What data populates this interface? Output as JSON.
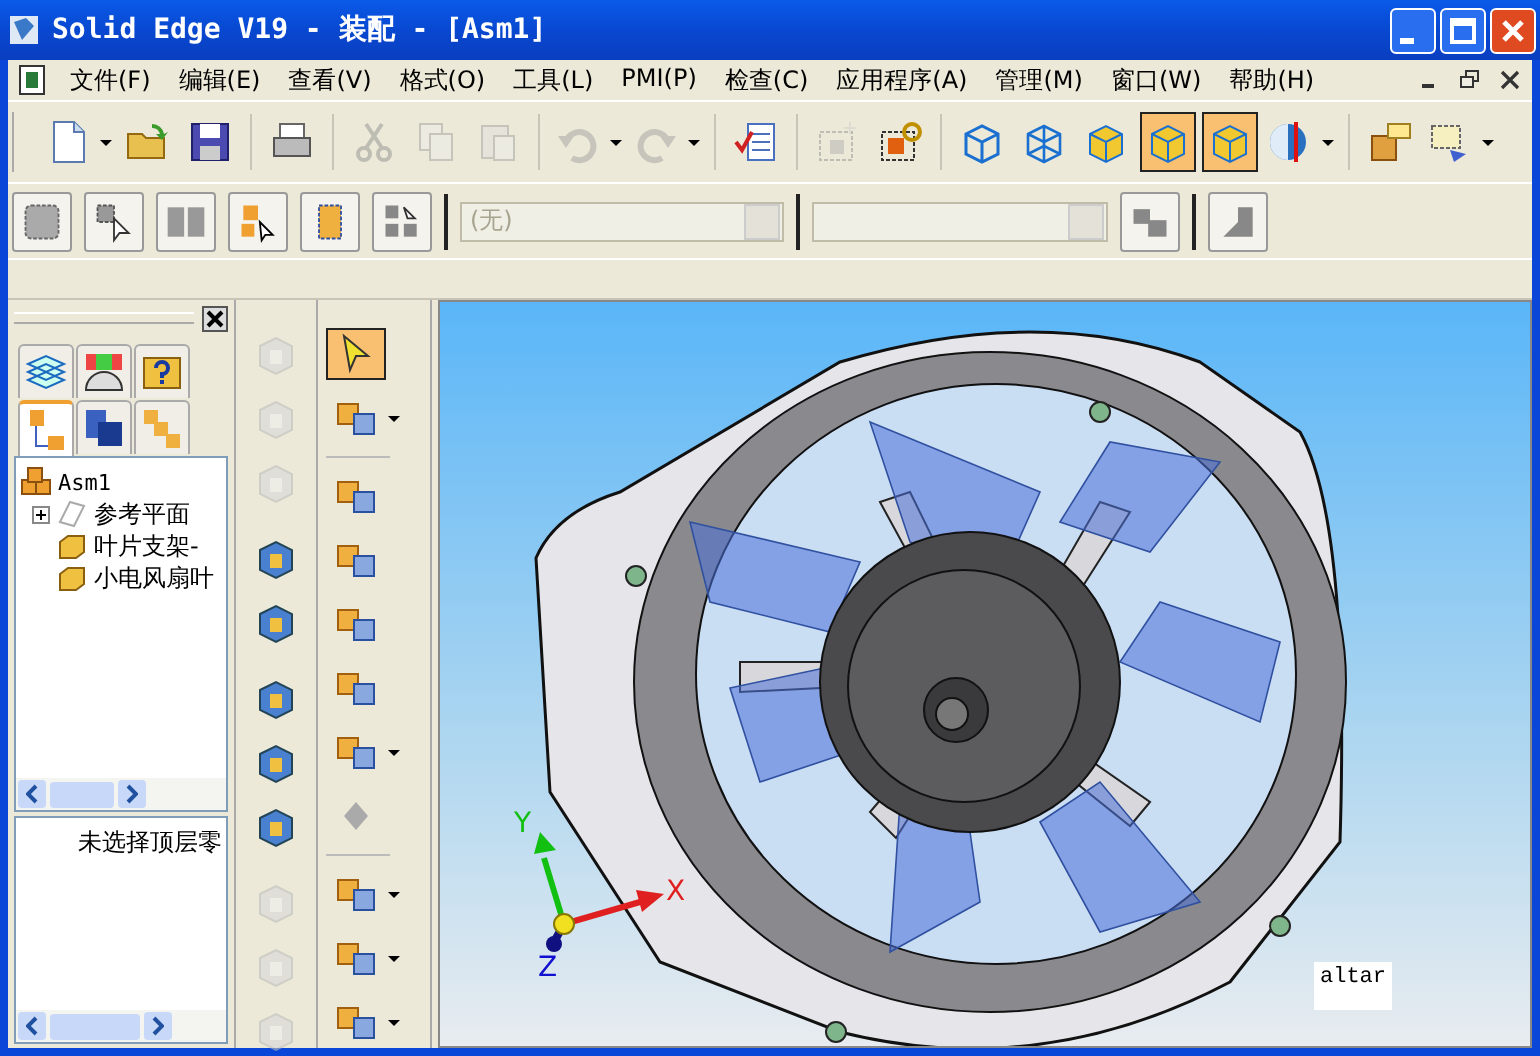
{
  "window": {
    "title": "Solid Edge V19 - 装配 - [Asm1]"
  },
  "menu": [
    "文件(F)",
    "编辑(E)",
    "查看(V)",
    "格式(O)",
    "工具(L)",
    "PMI(P)",
    "检查(C)",
    "应用程序(A)",
    "管理(M)",
    "窗口(W)",
    "帮助(H)"
  ],
  "toolbar": [
    {
      "dropdown": true,
      "disabled": false,
      "selected": false
    },
    {
      "dropdown": false,
      "disabled": false,
      "selected": false
    },
    {
      "dropdown": false,
      "disabled": false,
      "selected": false
    },
    {
      "dropdown": false,
      "disabled": false,
      "selected": false
    },
    {
      "dropdown": false,
      "disabled": true,
      "selected": false
    },
    {
      "dropdown": false,
      "disabled": true,
      "selected": false
    },
    {
      "dropdown": false,
      "disabled": true,
      "selected": false
    },
    {
      "dropdown": true,
      "disabled": true,
      "selected": false
    },
    {
      "dropdown": true,
      "disabled": true,
      "selected": false
    },
    {
      "dropdown": false,
      "disabled": false,
      "selected": false
    },
    {
      "dropdown": false,
      "disabled": true,
      "selected": false
    },
    {
      "dropdown": false,
      "disabled": false,
      "selected": false
    },
    {
      "dropdown": false,
      "disabled": false,
      "selected": false
    },
    {
      "dropdown": false,
      "disabled": false,
      "selected": false
    },
    {
      "dropdown": false,
      "disabled": false,
      "selected": false
    },
    {
      "dropdown": false,
      "disabled": false,
      "selected": true
    },
    {
      "dropdown": false,
      "disabled": false,
      "selected": true
    },
    {
      "dropdown": true,
      "disabled": false,
      "selected": false
    },
    {
      "dropdown": false,
      "disabled": false,
      "selected": false
    },
    {
      "dropdown": true,
      "disabled": false,
      "selected": false
    }
  ],
  "toolbar2": {
    "layer_select": {
      "value": "(无)",
      "disabled": true
    },
    "style_select": {
      "disabled": true
    }
  },
  "panel": {
    "tabs": [
      {
        "selected": false
      },
      {
        "selected": false
      },
      {
        "selected": false
      },
      {
        "selected": true
      },
      {
        "selected": false
      },
      {
        "selected": false
      }
    ],
    "tree": [
      {
        "label": "Asm1",
        "children": [
          {
            "label": "参考平面",
            "expanded": false,
            "expandable": true
          },
          {
            "label": "叶片支架-",
            "expandable": false
          },
          {
            "label": "小电风扇叶",
            "expandable": false
          }
        ]
      }
    ],
    "details_text": "未选择顶层零"
  },
  "commands_a": [
    {
      "disabled": true
    },
    {
      "disabled": true
    },
    {
      "disabled": true
    },
    {
      "disabled": false
    },
    {
      "disabled": false
    },
    {
      "disabled": false
    },
    {
      "disabled": false
    },
    {
      "disabled": false
    },
    {
      "disabled": true
    },
    {
      "disabled": true
    },
    {
      "disabled": true
    }
  ],
  "commands_b": [
    {
      "selected": true,
      "dropdown": false
    },
    {
      "selected": false,
      "dropdown": true
    },
    {
      "selected": false,
      "dropdown": false
    },
    {
      "selected": false,
      "dropdown": false
    },
    {
      "selected": false,
      "dropdown": false
    },
    {
      "selected": false,
      "dropdown": false
    },
    {
      "selected": false,
      "dropdown": true
    },
    {
      "selected": false,
      "dropdown": false
    },
    {
      "selected": false,
      "dropdown": true
    },
    {
      "selected": false,
      "dropdown": true
    },
    {
      "selected": false,
      "dropdown": true
    }
  ],
  "viewport": {
    "axes": {
      "x": "X",
      "y": "Y",
      "z": "Z"
    },
    "label": "altar"
  }
}
